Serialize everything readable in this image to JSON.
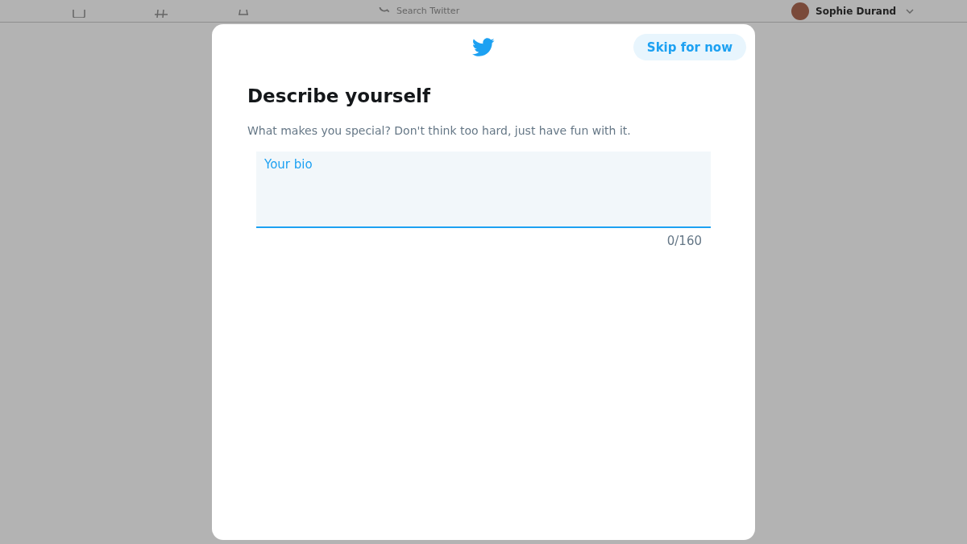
{
  "top_bar": {
    "search": {
      "placeholder": "Search Twitter"
    },
    "user_name": "Sophie Durand"
  },
  "dialog": {
    "skip_button": "Skip for now",
    "title": "Describe yourself",
    "subtitle": "What makes you special? Don't think too hard, just have fun with it.",
    "bio_field": {
      "placeholder": "Your bio",
      "focused": true
    },
    "counter": "0/160"
  }
}
